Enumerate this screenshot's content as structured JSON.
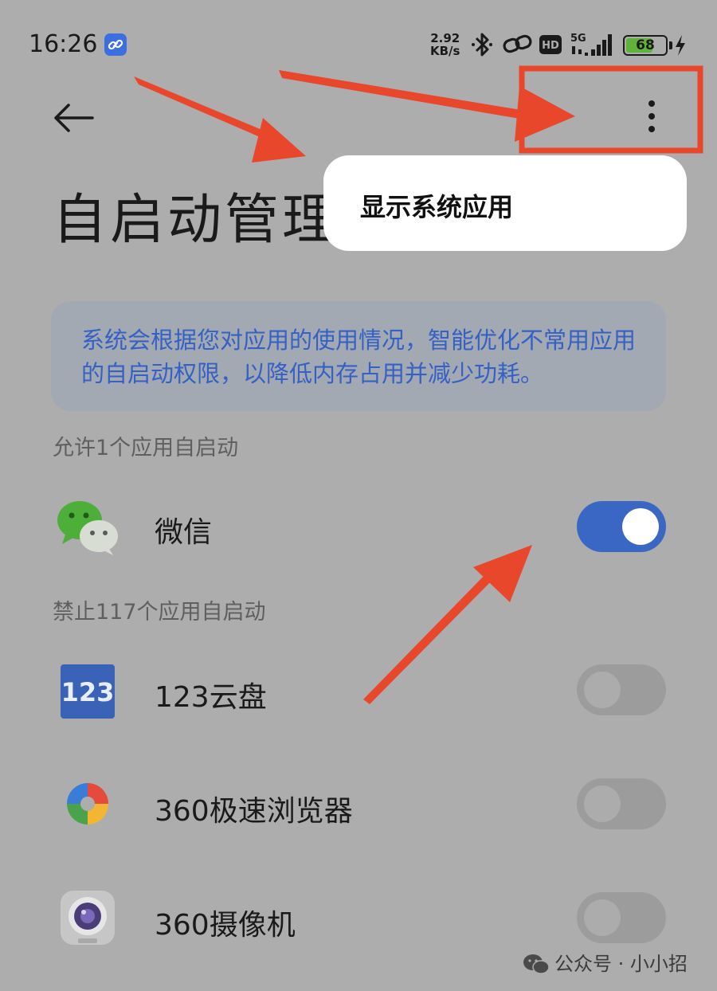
{
  "status_bar": {
    "time": "16:26",
    "net_speed_value": "2.92",
    "net_speed_unit": "KB/s",
    "hd_badge": "HD",
    "network_type": "5G",
    "battery_level": "68",
    "icons": [
      "link-icon",
      "bluetooth-icon",
      "hotspot-icon",
      "signal-icon",
      "charging-icon"
    ]
  },
  "header": {
    "back_icon": "arrow-left-icon",
    "more_icon": "more-vertical-icon",
    "title": "自启动管理"
  },
  "popup_menu": {
    "items": [
      {
        "label": "显示系统应用"
      }
    ]
  },
  "info_card": {
    "text": "系统会根据您对应用的使用情况，智能优化不常用应用的自启动权限，以降低内存占用并减少功耗。"
  },
  "allowed_section": {
    "label": "允许1个应用自启动",
    "apps": [
      {
        "name": "微信",
        "enabled": true,
        "icon": "wechat-icon"
      }
    ]
  },
  "blocked_section": {
    "label": "禁止117个应用自启动",
    "apps": [
      {
        "name": "123云盘",
        "enabled": false,
        "icon": "123pan-icon",
        "icon_text": "123"
      },
      {
        "name": "360极速浏览器",
        "enabled": false,
        "icon": "360-browser-icon"
      },
      {
        "name": "360摄像机",
        "enabled": false,
        "icon": "360-camera-icon"
      }
    ]
  },
  "watermark": {
    "text": "公众号 · 小小招"
  },
  "colors": {
    "accent": "#3a66c4",
    "annotation": "#e8472c",
    "overlay_bg": "#adadad"
  }
}
